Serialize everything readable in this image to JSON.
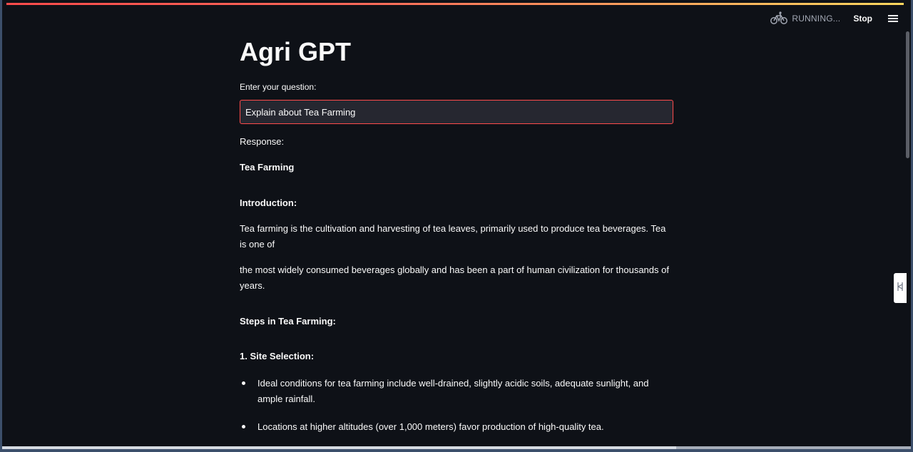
{
  "app": {
    "title": "Agri GPT"
  },
  "status": {
    "running_label": "RUNNING...",
    "stop_label": "Stop",
    "running_icon": "bicycle-icon",
    "menu_icon": "hamburger-menu-icon"
  },
  "question": {
    "label": "Enter your question:",
    "value": "Explain about Tea Farming"
  },
  "response": {
    "label": "Response:",
    "title": "Tea Farming",
    "intro_heading": "Introduction:",
    "intro_p1": "Tea farming is the cultivation and harvesting of tea leaves, primarily used to produce tea beverages. Tea is one of",
    "intro_p2": "the most widely consumed beverages globally and has been a part of human civilization for thousands of years.",
    "steps_heading": "Steps in Tea Farming:",
    "site_heading": "1. Site Selection:",
    "site_items": [
      "Ideal conditions for tea farming include well-drained, slightly acidic soils, adequate sunlight, and ample rainfall.",
      "Locations at higher altitudes (over 1,000 meters) favor production of high-quality tea."
    ]
  },
  "colors": {
    "background": "#0e1117",
    "input_background": "#262730",
    "input_border": "#ff4b4b",
    "text": "#fafafa",
    "muted": "#a3a8b4"
  }
}
